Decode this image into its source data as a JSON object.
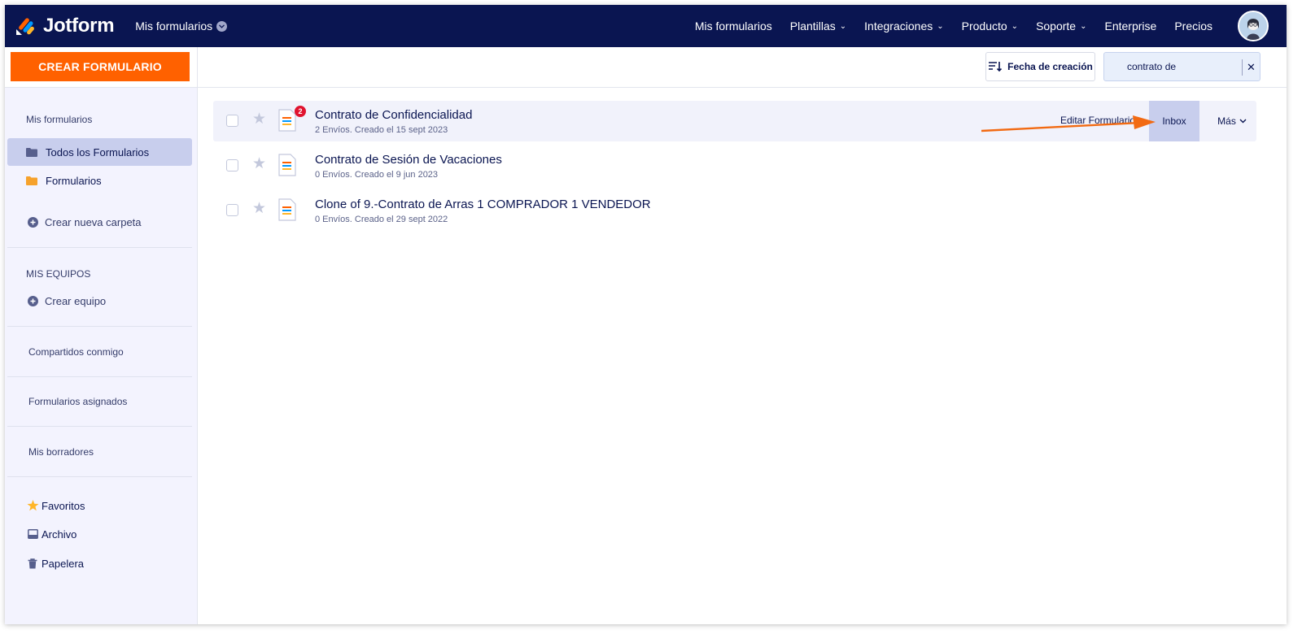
{
  "app": {
    "brand": "Jotform",
    "workspace_label": "Mis formularios"
  },
  "nav": {
    "items": [
      {
        "label": "Mis formularios",
        "caret": false
      },
      {
        "label": "Plantillas",
        "caret": true
      },
      {
        "label": "Integraciones",
        "caret": true
      },
      {
        "label": "Producto",
        "caret": true
      },
      {
        "label": "Soporte",
        "caret": true
      },
      {
        "label": "Enterprise",
        "caret": false
      },
      {
        "label": "Precios",
        "caret": false
      }
    ]
  },
  "toolbar": {
    "create_label": "CREAR FORMULARIO",
    "sort_label": "Fecha de creación",
    "search_value": "contrato de",
    "clear_symbol": "✕"
  },
  "sidebar": {
    "heading": "Mis formularios",
    "items": [
      {
        "label": "Todos los Formularios",
        "icon": "folder-icon",
        "color": "#575f8d",
        "active": true
      },
      {
        "label": "Formularios",
        "icon": "folder-icon",
        "color": "#f6a22c",
        "active": false
      }
    ],
    "new_folder": "Crear nueva carpeta",
    "teams_heading": "MIS EQUIPOS",
    "new_team": "Crear equipo",
    "shared": "Compartidos conmigo",
    "assigned": "Formularios asignados",
    "drafts": "Mis borradores",
    "favorites": "Favoritos",
    "archive": "Archivo",
    "trash": "Papelera"
  },
  "forms": [
    {
      "title": "Contrato de Confidencialidad",
      "meta": "2 Envíos. Creado el 15 sept 2023",
      "badge": "2",
      "hover": true
    },
    {
      "title": "Contrato de Sesión de Vacaciones",
      "meta": "0 Envíos. Creado el 9 jun 2023",
      "badge": "",
      "hover": false
    },
    {
      "title": "Clone of 9.-Contrato de Arras 1 COMPRADOR 1 VENDEDOR",
      "meta": "0 Envíos. Creado el 29 sept 2022",
      "badge": "",
      "hover": false
    }
  ],
  "row_actions": {
    "edit_label": "Editar Formulario",
    "inbox_label": "Inbox",
    "more_label": "Más"
  },
  "colors": {
    "navbar": "#0a1551",
    "accent": "#ff6100",
    "arrow": "#f26a12",
    "badge": "#e0132f"
  }
}
